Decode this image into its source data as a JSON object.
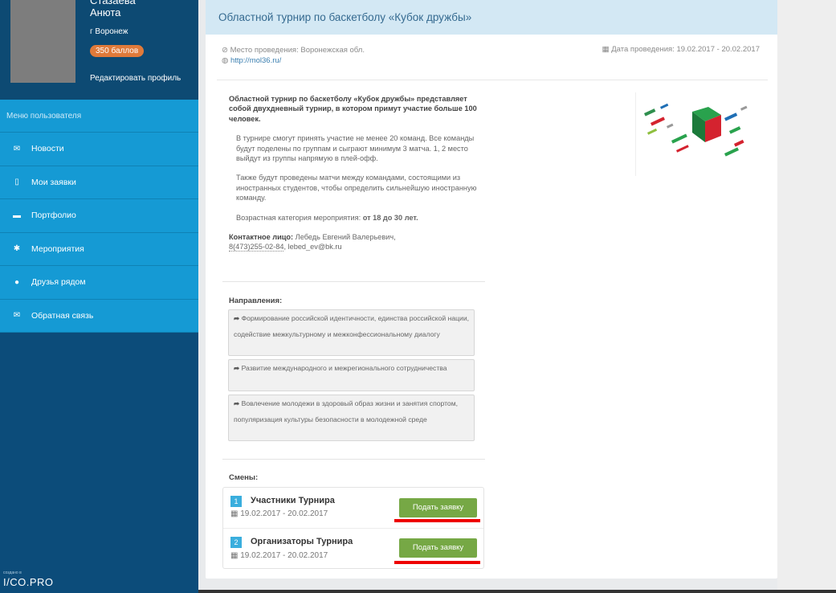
{
  "profile": {
    "name": "Стазаева\nАнюта",
    "city": "г Воронеж",
    "points": "350 баллов",
    "edit": "Редактировать профиль"
  },
  "menu": {
    "header": "Меню пользователя",
    "items": [
      {
        "label": "Новости",
        "icon": "megaphone-icon",
        "glyph": "✉"
      },
      {
        "label": "Мои заявки",
        "icon": "bookmark-icon",
        "glyph": "▯"
      },
      {
        "label": "Портфолио",
        "icon": "folder-icon",
        "glyph": "▬"
      },
      {
        "label": "Мероприятия",
        "icon": "people-icon",
        "glyph": "✱"
      },
      {
        "label": "Друзья рядом",
        "icon": "map-marker-icon",
        "glyph": "●"
      },
      {
        "label": "Обратная связь",
        "icon": "envelope-icon",
        "glyph": "✉"
      }
    ]
  },
  "footer": {
    "small": "создано в",
    "brand": "I/CO.PRO"
  },
  "event": {
    "title": "Областной турнир по баскетболу «Кубок дружбы»",
    "place": "Место проведения: Воронежская обл.",
    "link": "http://mol36.ru/",
    "date": "Дата проведения: 19.02.2017 - 20.02.2017",
    "lead": "Областной турнир по баскетболу «Кубок дружбы» представляет собой двухдневный турнир, в котором примут участие больше 100 человек.",
    "p1": "В турнире смогут принять участие не менее 20 команд. Все команды будут поделены по группам и сыграют минимум 3 матча. 1, 2 место выйдут из группы напрямую в плей-офф.",
    "p2": "Также будут проведены матчи между командами, состоящими из иностранных студентов, чтобы определить сильнейшую иностранную команду.",
    "age_label": "Возрастная категория мероприятия:",
    "age_value": "от 18 до 30 лет.",
    "contact_label": "Контактное лицо:",
    "contact_name": "Лебедь Евгений Валерьевич,",
    "contact_phone": "8(473)255-02-84",
    "contact_email": ", lebed_ev@bk.ru"
  },
  "directions": {
    "title": "Направления:",
    "items": [
      "Формирование российской идентичности, единства российской нации, содействие межкультурному и межконфессиональному диалогу",
      "Развитие международного и межрегионального сотрудничества",
      "Вовлечение молодежи в здоровый образ жизни и занятия спортом, популяризация культуры безопасности в молодежной среде"
    ]
  },
  "shifts": {
    "title": "Смены:",
    "items": [
      {
        "num": "1",
        "name": "Участники Турнира",
        "date": "19.02.2017 - 20.02.2017",
        "button": "Подать заявку"
      },
      {
        "num": "2",
        "name": "Организаторы Турнира",
        "date": "19.02.2017 - 20.02.2017",
        "button": "Подать заявку"
      }
    ]
  },
  "colors": {
    "sidebar": "#0c4c7a",
    "menu": "#159ad4",
    "accent_orange": "#e07a3a",
    "button_green": "#76a845",
    "highlight_red": "#ee0000"
  }
}
